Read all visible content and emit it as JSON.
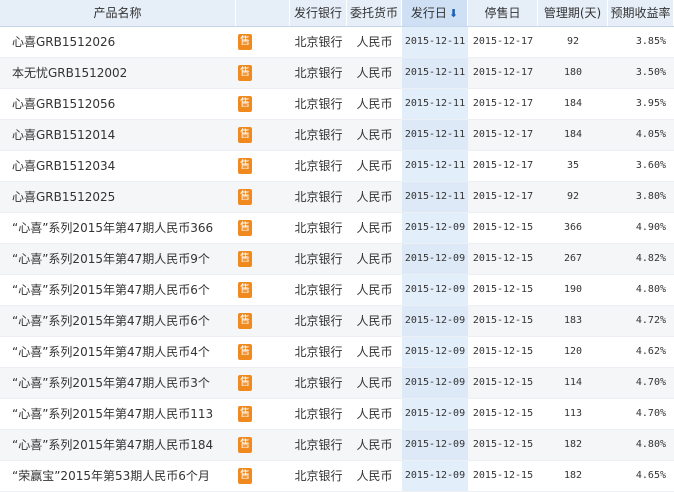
{
  "headers": {
    "name": "产品名称",
    "bank": "发行银行",
    "currency": "委托货币",
    "issue_date": "发行日",
    "stop_date": "停售日",
    "term": "管理期(天)",
    "yield": "预期收益率"
  },
  "sale_label": "售",
  "rows": [
    {
      "name": "心喜GRB1512026",
      "bank": "北京银行",
      "currency": "人民币",
      "issue": "2015-12-11",
      "stop": "2015-12-17",
      "term": "92",
      "yield": "3.85%"
    },
    {
      "name": "本无忧GRB1512002",
      "bank": "北京银行",
      "currency": "人民币",
      "issue": "2015-12-11",
      "stop": "2015-12-17",
      "term": "180",
      "yield": "3.50%"
    },
    {
      "name": "心喜GRB1512056",
      "bank": "北京银行",
      "currency": "人民币",
      "issue": "2015-12-11",
      "stop": "2015-12-17",
      "term": "184",
      "yield": "3.95%"
    },
    {
      "name": "心喜GRB1512014",
      "bank": "北京银行",
      "currency": "人民币",
      "issue": "2015-12-11",
      "stop": "2015-12-17",
      "term": "184",
      "yield": "4.05%"
    },
    {
      "name": "心喜GRB1512034",
      "bank": "北京银行",
      "currency": "人民币",
      "issue": "2015-12-11",
      "stop": "2015-12-17",
      "term": "35",
      "yield": "3.60%"
    },
    {
      "name": "心喜GRB1512025",
      "bank": "北京银行",
      "currency": "人民币",
      "issue": "2015-12-11",
      "stop": "2015-12-17",
      "term": "92",
      "yield": "3.80%"
    },
    {
      "name": "“心喜”系列2015年第47期人民币366",
      "bank": "北京银行",
      "currency": "人民币",
      "issue": "2015-12-09",
      "stop": "2015-12-15",
      "term": "366",
      "yield": "4.90%"
    },
    {
      "name": "“心喜”系列2015年第47期人民币9个",
      "bank": "北京银行",
      "currency": "人民币",
      "issue": "2015-12-09",
      "stop": "2015-12-15",
      "term": "267",
      "yield": "4.82%"
    },
    {
      "name": "“心喜”系列2015年第47期人民币6个",
      "bank": "北京银行",
      "currency": "人民币",
      "issue": "2015-12-09",
      "stop": "2015-12-15",
      "term": "190",
      "yield": "4.80%"
    },
    {
      "name": "“心喜”系列2015年第47期人民币6个",
      "bank": "北京银行",
      "currency": "人民币",
      "issue": "2015-12-09",
      "stop": "2015-12-15",
      "term": "183",
      "yield": "4.72%"
    },
    {
      "name": "“心喜”系列2015年第47期人民币4个",
      "bank": "北京银行",
      "currency": "人民币",
      "issue": "2015-12-09",
      "stop": "2015-12-15",
      "term": "120",
      "yield": "4.62%"
    },
    {
      "name": "“心喜”系列2015年第47期人民币3个",
      "bank": "北京银行",
      "currency": "人民币",
      "issue": "2015-12-09",
      "stop": "2015-12-15",
      "term": "114",
      "yield": "4.70%"
    },
    {
      "name": "“心喜”系列2015年第47期人民币113",
      "bank": "北京银行",
      "currency": "人民币",
      "issue": "2015-12-09",
      "stop": "2015-12-15",
      "term": "113",
      "yield": "4.70%"
    },
    {
      "name": "“心喜”系列2015年第47期人民币184",
      "bank": "北京银行",
      "currency": "人民币",
      "issue": "2015-12-09",
      "stop": "2015-12-15",
      "term": "182",
      "yield": "4.80%"
    },
    {
      "name": "“荣赢宝”2015年第53期人民币6个月",
      "bank": "北京银行",
      "currency": "人民币",
      "issue": "2015-12-09",
      "stop": "2015-12-15",
      "term": "182",
      "yield": "4.65%"
    }
  ]
}
